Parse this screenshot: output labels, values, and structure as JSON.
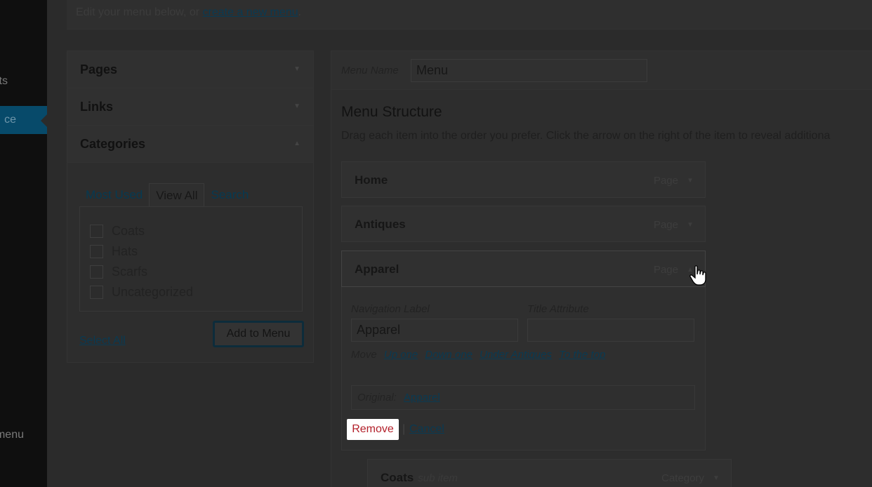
{
  "sidebar": {
    "posts_label": "ts",
    "appearance_label": "ce",
    "menus_label": "menu"
  },
  "top": {
    "intro_text": "Edit your menu below, or ",
    "create_link": "create a new menu",
    "period": "."
  },
  "accordion": {
    "sections": [
      {
        "label": "Pages",
        "caret": "▼"
      },
      {
        "label": "Links",
        "caret": "▼"
      },
      {
        "label": "Categories",
        "caret": "▲"
      }
    ],
    "tabs": [
      "Most Used",
      "View All",
      "Search"
    ],
    "categories": [
      "Coats",
      "Hats",
      "Scarfs",
      "Uncategorized"
    ],
    "select_all": "Select All",
    "add_button": "Add to Menu"
  },
  "menu": {
    "name_label": "Menu Name",
    "name_value": "Menu",
    "structure_title": "Menu Structure",
    "structure_desc": "Drag each item into the order you prefer. Click the arrow on the right of the item to reveal additiona",
    "items": [
      {
        "title": "Home",
        "type": "Page"
      },
      {
        "title": "Antiques",
        "type": "Page"
      },
      {
        "title": "Apparel",
        "type": "Page"
      },
      {
        "title": "Coats",
        "sub": "sub item",
        "type": "Category"
      }
    ],
    "caret": "▼",
    "settings": {
      "nav_label": "Navigation Label",
      "nav_value": "Apparel",
      "title_attr_label": "Title Attribute",
      "title_attr_value": "",
      "move_label": "Move",
      "move_links": [
        "Up one",
        "Down one",
        "Under Antiques",
        "To the top"
      ],
      "original_label": "Original:",
      "original_link": "Apparel",
      "remove": "Remove",
      "separator": "|",
      "cancel": "Cancel"
    }
  }
}
